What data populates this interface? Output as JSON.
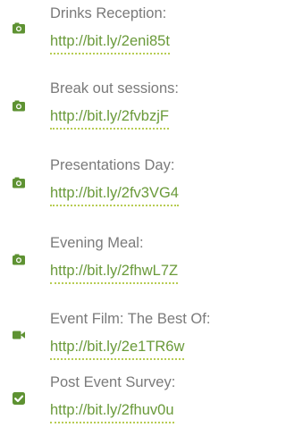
{
  "accent_color": "#6a9a3a",
  "items": [
    {
      "label": "Drinks Reception:",
      "url": "http://bit.ly/2eni85t",
      "icon": "camera-icon"
    },
    {
      "label": "Break out sessions:",
      "url": "http://bit.ly/2fvbzjF",
      "icon": "camera-icon"
    },
    {
      "label": "Presentations Day:",
      "url": "http://bit.ly/2fv3VG4",
      "icon": "camera-icon"
    },
    {
      "label": "Evening Meal:",
      "url": "http://bit.ly/2fhwL7Z",
      "icon": "camera-icon"
    },
    {
      "label": "Event Film: The Best Of:",
      "url": "http://bit.ly/2e1TR6w",
      "icon": "video-camera-icon"
    },
    {
      "label": "Post Event Survey:",
      "url": "http://bit.ly/2fhuv0u",
      "icon": "checkbox-icon"
    }
  ]
}
